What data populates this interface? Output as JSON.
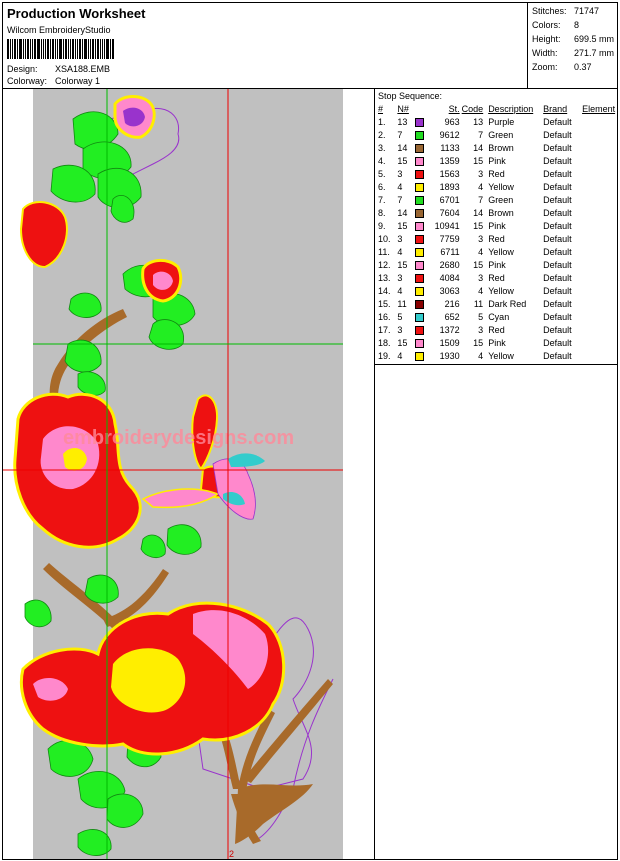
{
  "header": {
    "title": "Production Worksheet",
    "software": "Wilcom EmbroideryStudio",
    "design_label": "Design:",
    "design_value": "XSA188.EMB",
    "colorway_label": "Colorway:",
    "colorway_value": "Colorway 1"
  },
  "stats": [
    {
      "label": "Stitches:",
      "value": "71747"
    },
    {
      "label": "Colors:",
      "value": "8"
    },
    {
      "label": "Height:",
      "value": "699.5 mm"
    },
    {
      "label": "Width:",
      "value": "271.7 mm"
    },
    {
      "label": "Zoom:",
      "value": "0.37"
    }
  ],
  "stop_sequence": {
    "title": "Stop Sequence:",
    "columns": [
      "#",
      "N#",
      "St.",
      "Code",
      "Description",
      "Brand",
      "Element"
    ],
    "rows": [
      {
        "idx": "1.",
        "n": "13",
        "color": "#9933cc",
        "st": "963",
        "code": "13",
        "desc": "Purple",
        "brand": "Default"
      },
      {
        "idx": "2.",
        "n": "7",
        "color": "#22dd22",
        "st": "9612",
        "code": "7",
        "desc": "Green",
        "brand": "Default"
      },
      {
        "idx": "3.",
        "n": "14",
        "color": "#996633",
        "st": "1133",
        "code": "14",
        "desc": "Brown",
        "brand": "Default"
      },
      {
        "idx": "4.",
        "n": "15",
        "color": "#ff88cc",
        "st": "1359",
        "code": "15",
        "desc": "Pink",
        "brand": "Default"
      },
      {
        "idx": "5.",
        "n": "3",
        "color": "#ee1111",
        "st": "1563",
        "code": "3",
        "desc": "Red",
        "brand": "Default"
      },
      {
        "idx": "6.",
        "n": "4",
        "color": "#ffee00",
        "st": "1893",
        "code": "4",
        "desc": "Yellow",
        "brand": "Default"
      },
      {
        "idx": "7.",
        "n": "7",
        "color": "#22dd22",
        "st": "6701",
        "code": "7",
        "desc": "Green",
        "brand": "Default"
      },
      {
        "idx": "8.",
        "n": "14",
        "color": "#996633",
        "st": "7604",
        "code": "14",
        "desc": "Brown",
        "brand": "Default"
      },
      {
        "idx": "9.",
        "n": "15",
        "color": "#ff88cc",
        "st": "10941",
        "code": "15",
        "desc": "Pink",
        "brand": "Default"
      },
      {
        "idx": "10.",
        "n": "3",
        "color": "#ee1111",
        "st": "7759",
        "code": "3",
        "desc": "Red",
        "brand": "Default"
      },
      {
        "idx": "11.",
        "n": "4",
        "color": "#ffee00",
        "st": "6711",
        "code": "4",
        "desc": "Yellow",
        "brand": "Default"
      },
      {
        "idx": "12.",
        "n": "15",
        "color": "#ff88cc",
        "st": "2680",
        "code": "15",
        "desc": "Pink",
        "brand": "Default"
      },
      {
        "idx": "13.",
        "n": "3",
        "color": "#ee1111",
        "st": "4084",
        "code": "3",
        "desc": "Red",
        "brand": "Default"
      },
      {
        "idx": "14.",
        "n": "4",
        "color": "#ffee00",
        "st": "3063",
        "code": "4",
        "desc": "Yellow",
        "brand": "Default"
      },
      {
        "idx": "15.",
        "n": "11",
        "color": "#880000",
        "st": "216",
        "code": "11",
        "desc": "Dark Red",
        "brand": "Default"
      },
      {
        "idx": "16.",
        "n": "5",
        "color": "#33cccc",
        "st": "652",
        "code": "5",
        "desc": "Cyan",
        "brand": "Default"
      },
      {
        "idx": "17.",
        "n": "3",
        "color": "#ee1111",
        "st": "1372",
        "code": "3",
        "desc": "Red",
        "brand": "Default"
      },
      {
        "idx": "18.",
        "n": "15",
        "color": "#ff88cc",
        "st": "1509",
        "code": "15",
        "desc": "Pink",
        "brand": "Default"
      },
      {
        "idx": "19.",
        "n": "4",
        "color": "#ffee00",
        "st": "1930",
        "code": "4",
        "desc": "Yellow",
        "brand": "Default"
      }
    ]
  },
  "preview": {
    "watermark": "embroiderydesigns.com",
    "marker_label": "2",
    "colors": {
      "background": "#c0c0c0",
      "green": "#22ee22",
      "red": "#ee1111",
      "pink": "#ff88cc",
      "yellow": "#ffee00",
      "brown": "#a86a2a",
      "purple": "#9933cc",
      "cyan": "#33cccc",
      "guide_red": "#ee0000",
      "guide_green": "#00bb00"
    }
  }
}
